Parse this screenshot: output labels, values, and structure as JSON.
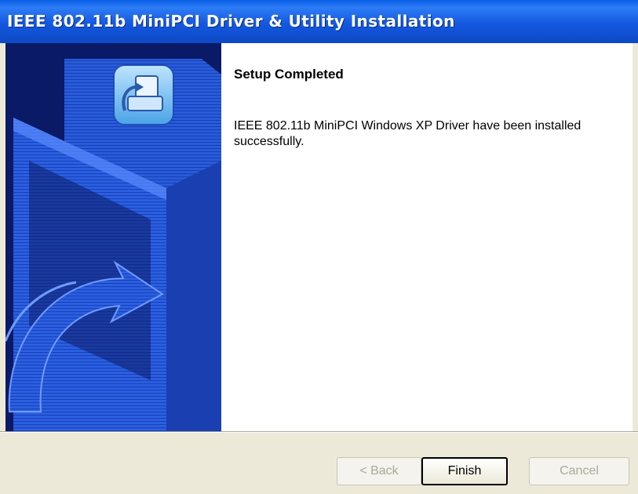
{
  "window": {
    "title": "IEEE 802.11b MiniPCI Driver & Utility Installation"
  },
  "content": {
    "heading": "Setup Completed",
    "message": "IEEE 802.11b MiniPCI Windows XP Driver have been installed successfully."
  },
  "buttons": {
    "back_label": "< Back",
    "finish_label": "Finish",
    "cancel_label": "Cancel"
  },
  "icons": {
    "side_art": "installer-graphic-icon",
    "emblem": "device-install-icon"
  },
  "colors": {
    "title_bar": "#1458e0",
    "side_panel": "#0b1a66",
    "art_blue": "#2a5fe0"
  }
}
